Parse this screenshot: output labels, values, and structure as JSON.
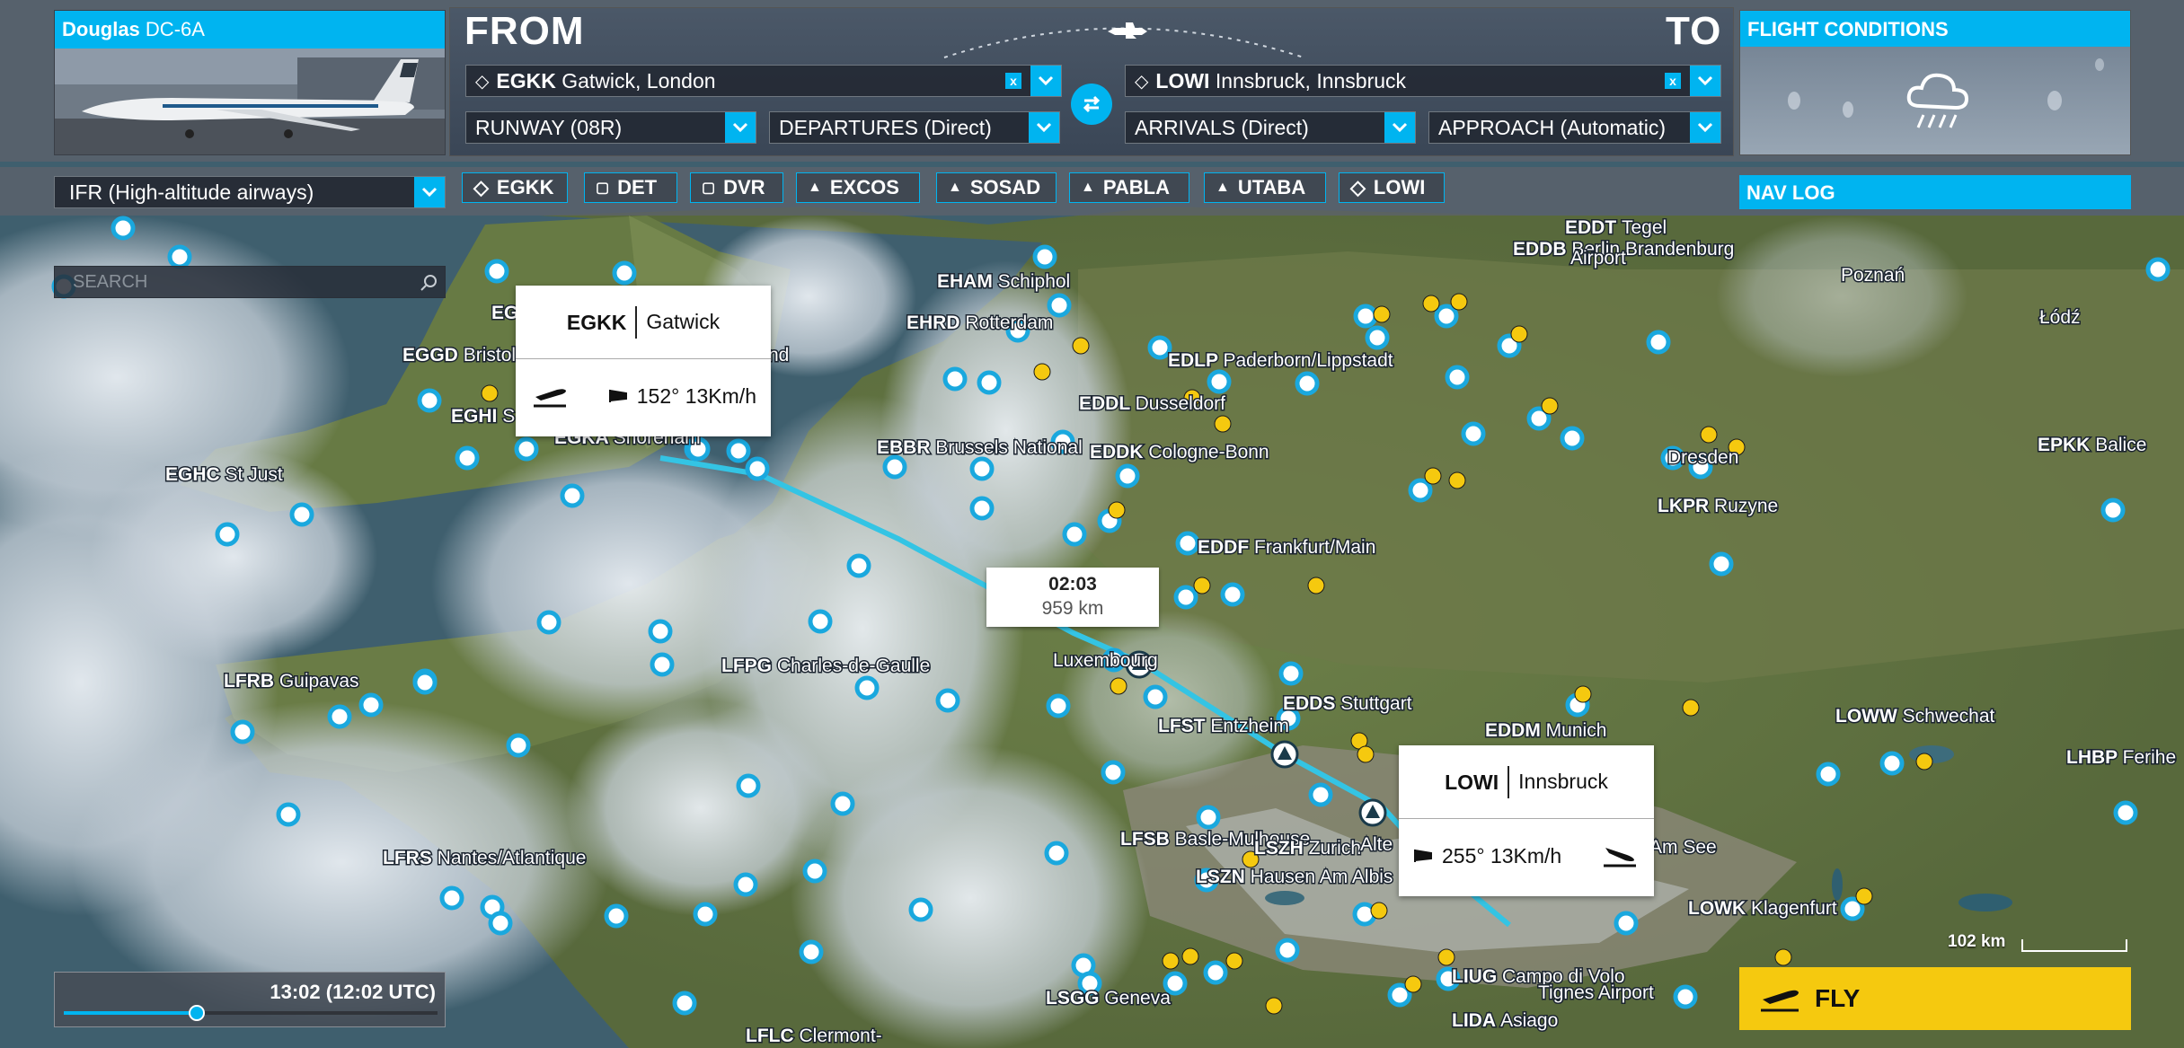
{
  "aircraft": {
    "brand": "Douglas",
    "model": "DC-6A"
  },
  "route": {
    "from_title": "FROM",
    "to_title": "TO",
    "from": {
      "code": "EGKK",
      "name": "Gatwick, London"
    },
    "to": {
      "code": "LOWI",
      "name": "Innsbruck, Innsbruck"
    },
    "clear_label": "x",
    "runway": "RUNWAY (08R)",
    "departures": "DEPARTURES (Direct)",
    "arrivals": "ARRIVALS (Direct)",
    "approach": "APPROACH (Automatic)"
  },
  "conditions": {
    "title": "FLIGHT CONDITIONS",
    "icon": "rain-cloud-icon"
  },
  "flight_plan_type": "IFR (High-altitude airways)",
  "waypoints": [
    {
      "name": "EGKK",
      "icon": "airport-diamond-icon"
    },
    {
      "name": "DET",
      "icon": "vor-square-icon"
    },
    {
      "name": "DVR",
      "icon": "vor-square-icon"
    },
    {
      "name": "EXCOS",
      "icon": "intersection-triangle-icon"
    },
    {
      "name": "SOSAD",
      "icon": "intersection-triangle-icon"
    },
    {
      "name": "PABLA",
      "icon": "intersection-triangle-icon"
    },
    {
      "name": "UTABA",
      "icon": "intersection-triangle-icon"
    },
    {
      "name": "LOWI",
      "icon": "airport-diamond-icon"
    }
  ],
  "nav_log": "NAV LOG",
  "search_placeholder": "SEARCH",
  "departure_card": {
    "code": "EGKK",
    "name": "Gatwick",
    "wind": "152° 13Km/h"
  },
  "arrival_card": {
    "code": "LOWI",
    "name": "Innsbruck",
    "wind": "255° 13Km/h"
  },
  "flight_summary": {
    "time": "02:03",
    "distance": "959 km"
  },
  "time_of_day": {
    "label": "13:02 (12:02 UTC)",
    "fraction": 0.355
  },
  "fly_label": "FLY",
  "scale_label": "102 km",
  "map_labels": [
    {
      "code": "EHAM",
      "name": "Schiphol"
    },
    {
      "code": "EHRD",
      "name": "Rotterdam"
    },
    {
      "code": "EDDB",
      "name": "Berlin Brandenburg"
    },
    {
      "code": "",
      "name": "Airport"
    },
    {
      "code": "EDDT",
      "name": "Tegel"
    },
    {
      "code": "",
      "name": "Poznań"
    },
    {
      "code": "",
      "name": "Łódź"
    },
    {
      "code": "EDLP",
      "name": "Paderborn/Lippstadt"
    },
    {
      "code": "EDDL",
      "name": "Dusseldorf"
    },
    {
      "code": "EDDK",
      "name": "Cologne-Bonn"
    },
    {
      "code": "EBBR",
      "name": "Brussels National"
    },
    {
      "code": "EGGD",
      "name": "Bristol"
    },
    {
      "code": "EGHC",
      "name": "St Just"
    },
    {
      "code": "EGHI",
      "name": "S"
    },
    {
      "code": "EG",
      "name": ""
    },
    {
      "code": "",
      "name": "nd"
    },
    {
      "code": "EGKA",
      "name": "Shoreham"
    },
    {
      "code": "",
      "name": "Dresden"
    },
    {
      "code": "LKPR",
      "name": "Ruzyne"
    },
    {
      "code": "EPKK",
      "name": "Balice"
    },
    {
      "code": "EDDF",
      "name": "Frankfurt/Main"
    },
    {
      "code": "LFPG",
      "name": "Charles-de-Gaulle"
    },
    {
      "code": "",
      "name": "Luxembourg"
    },
    {
      "code": "LFRB",
      "name": "Guipavas"
    },
    {
      "code": "EDDS",
      "name": "Stuttgart"
    },
    {
      "code": "LFST",
      "name": "Entzheim"
    },
    {
      "code": "EDDM",
      "name": "Munich"
    },
    {
      "code": "LOWW",
      "name": "Schwechat"
    },
    {
      "code": "LHBP",
      "name": "Ferihe"
    },
    {
      "code": "LFSB",
      "name": "Basle-Mulhouse"
    },
    {
      "code": "LSZH",
      "name": "Zurich"
    },
    {
      "code": "",
      "name": "Alte"
    },
    {
      "code": "",
      "name": "Am See"
    },
    {
      "code": "LSZN",
      "name": "Hausen Am Albis"
    },
    {
      "code": "LFRS",
      "name": "Nantes/Atlantique"
    },
    {
      "code": "LOWK",
      "name": "Klagenfurt"
    },
    {
      "code": "LIUG",
      "name": "Campo di Volo"
    },
    {
      "code": "",
      "name": "Tignes Airport"
    },
    {
      "code": "LIDA",
      "name": "Asiago"
    },
    {
      "code": "LSGG",
      "name": "Geneva"
    },
    {
      "code": "LFLC",
      "name": "Clermont-"
    }
  ]
}
